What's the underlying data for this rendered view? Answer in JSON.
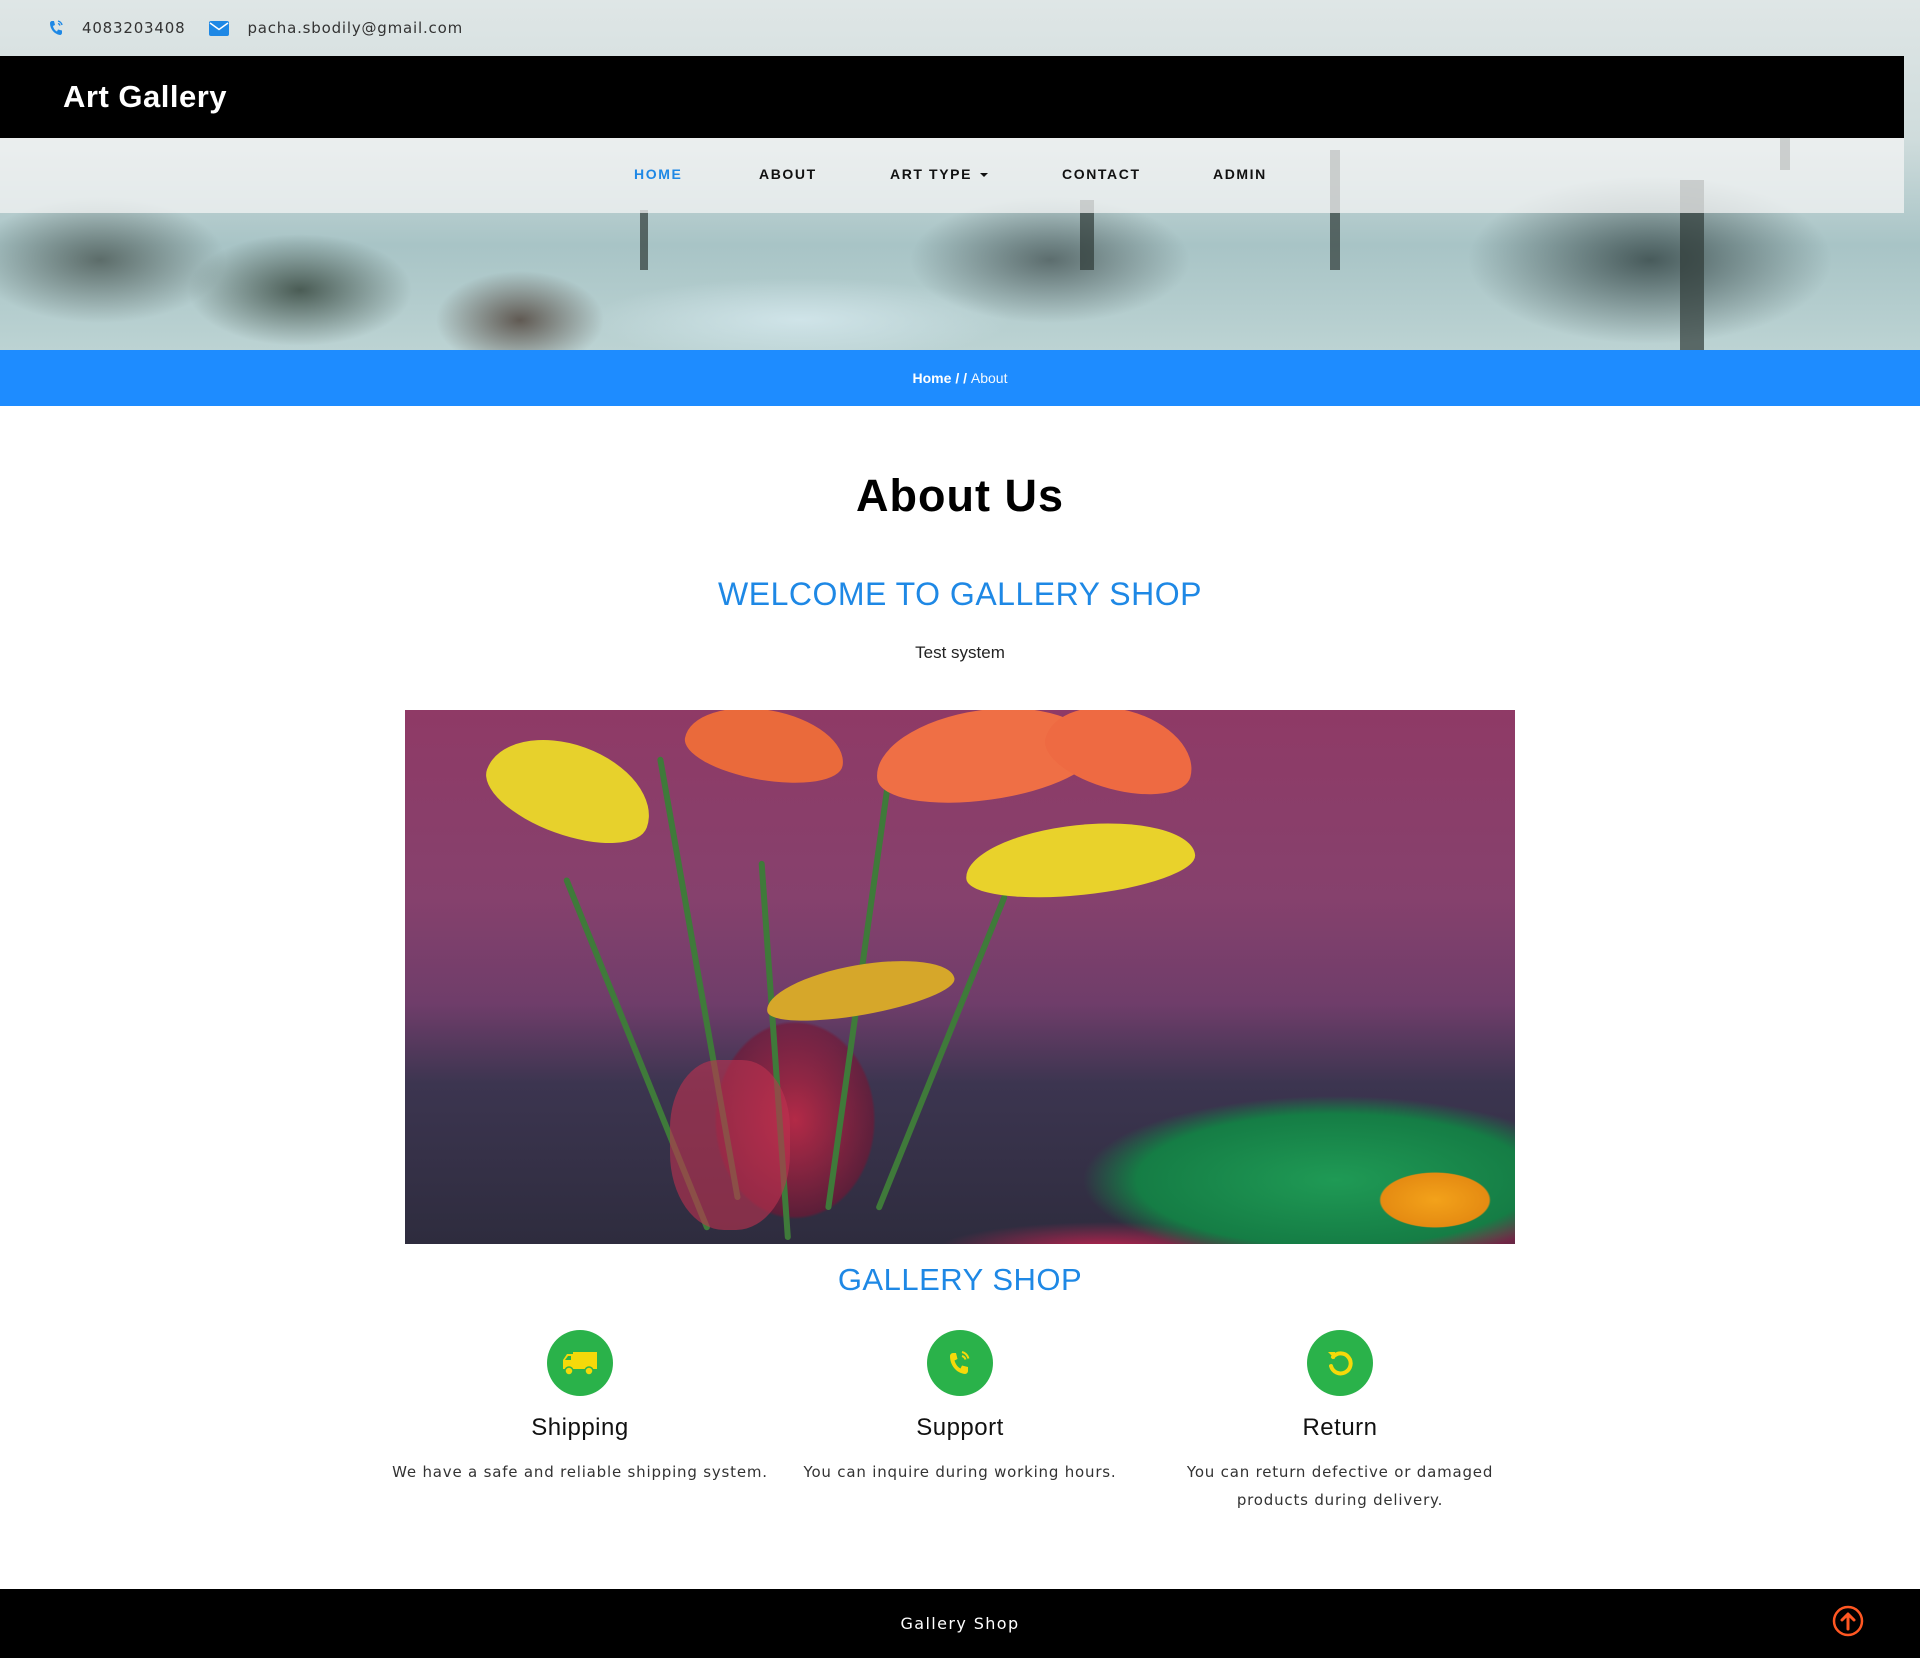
{
  "topbar": {
    "phone": "4083203408",
    "email": "pacha.sbodily@gmail.com"
  },
  "brand": "Art Gallery",
  "nav": {
    "items": [
      {
        "label": "HOME",
        "active": true
      },
      {
        "label": "ABOUT",
        "active": false
      },
      {
        "label": "ART TYPE",
        "active": false,
        "dropdown": true
      },
      {
        "label": "CONTACT",
        "active": false
      },
      {
        "label": "ADMIN",
        "active": false
      }
    ]
  },
  "breadcrumb": {
    "home": "Home",
    "separator": "/ /",
    "current": "About"
  },
  "main": {
    "title": "About Us",
    "welcome": "WELCOME TO GALLERY SHOP",
    "description": "Test system",
    "shop_title": "GALLERY SHOP",
    "features": [
      {
        "icon": "truck-icon",
        "title": "Shipping",
        "text": "We have a safe and reliable shipping system."
      },
      {
        "icon": "phone-icon",
        "title": "Support",
        "text": "You can inquire during working hours."
      },
      {
        "icon": "undo-icon",
        "title": "Return",
        "text": "You can return defective or damaged products during delivery."
      }
    ]
  },
  "footer": {
    "text": "Gallery Shop"
  },
  "colors": {
    "accent": "#1e88e5",
    "breadcrumb_bg": "#1e8cff",
    "feature_icon_bg": "#2ab24a",
    "feature_icon_fg": "#f5d90a",
    "scroll_top": "#ff5722"
  }
}
